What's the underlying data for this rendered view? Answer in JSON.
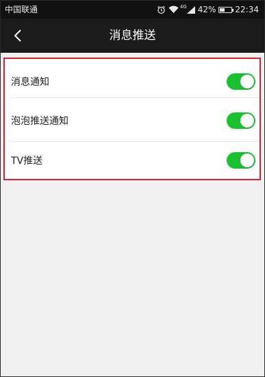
{
  "status_bar": {
    "carrier": "中国联通",
    "network": "4G",
    "battery": "42%",
    "battery_level": 0.42,
    "time": "22:34"
  },
  "header": {
    "title": "消息推送",
    "back_icon": "chevron-left-icon"
  },
  "settings": [
    {
      "label": "消息通知",
      "enabled": true
    },
    {
      "label": "泡泡推送通知",
      "enabled": true
    },
    {
      "label": "TV推送",
      "enabled": true
    }
  ],
  "colors": {
    "toggle_on": "#19c131",
    "highlight_border": "#e0202b",
    "title_bar": "#1b1b1b",
    "status_bar": "#111111",
    "background": "#f0f0f0"
  }
}
